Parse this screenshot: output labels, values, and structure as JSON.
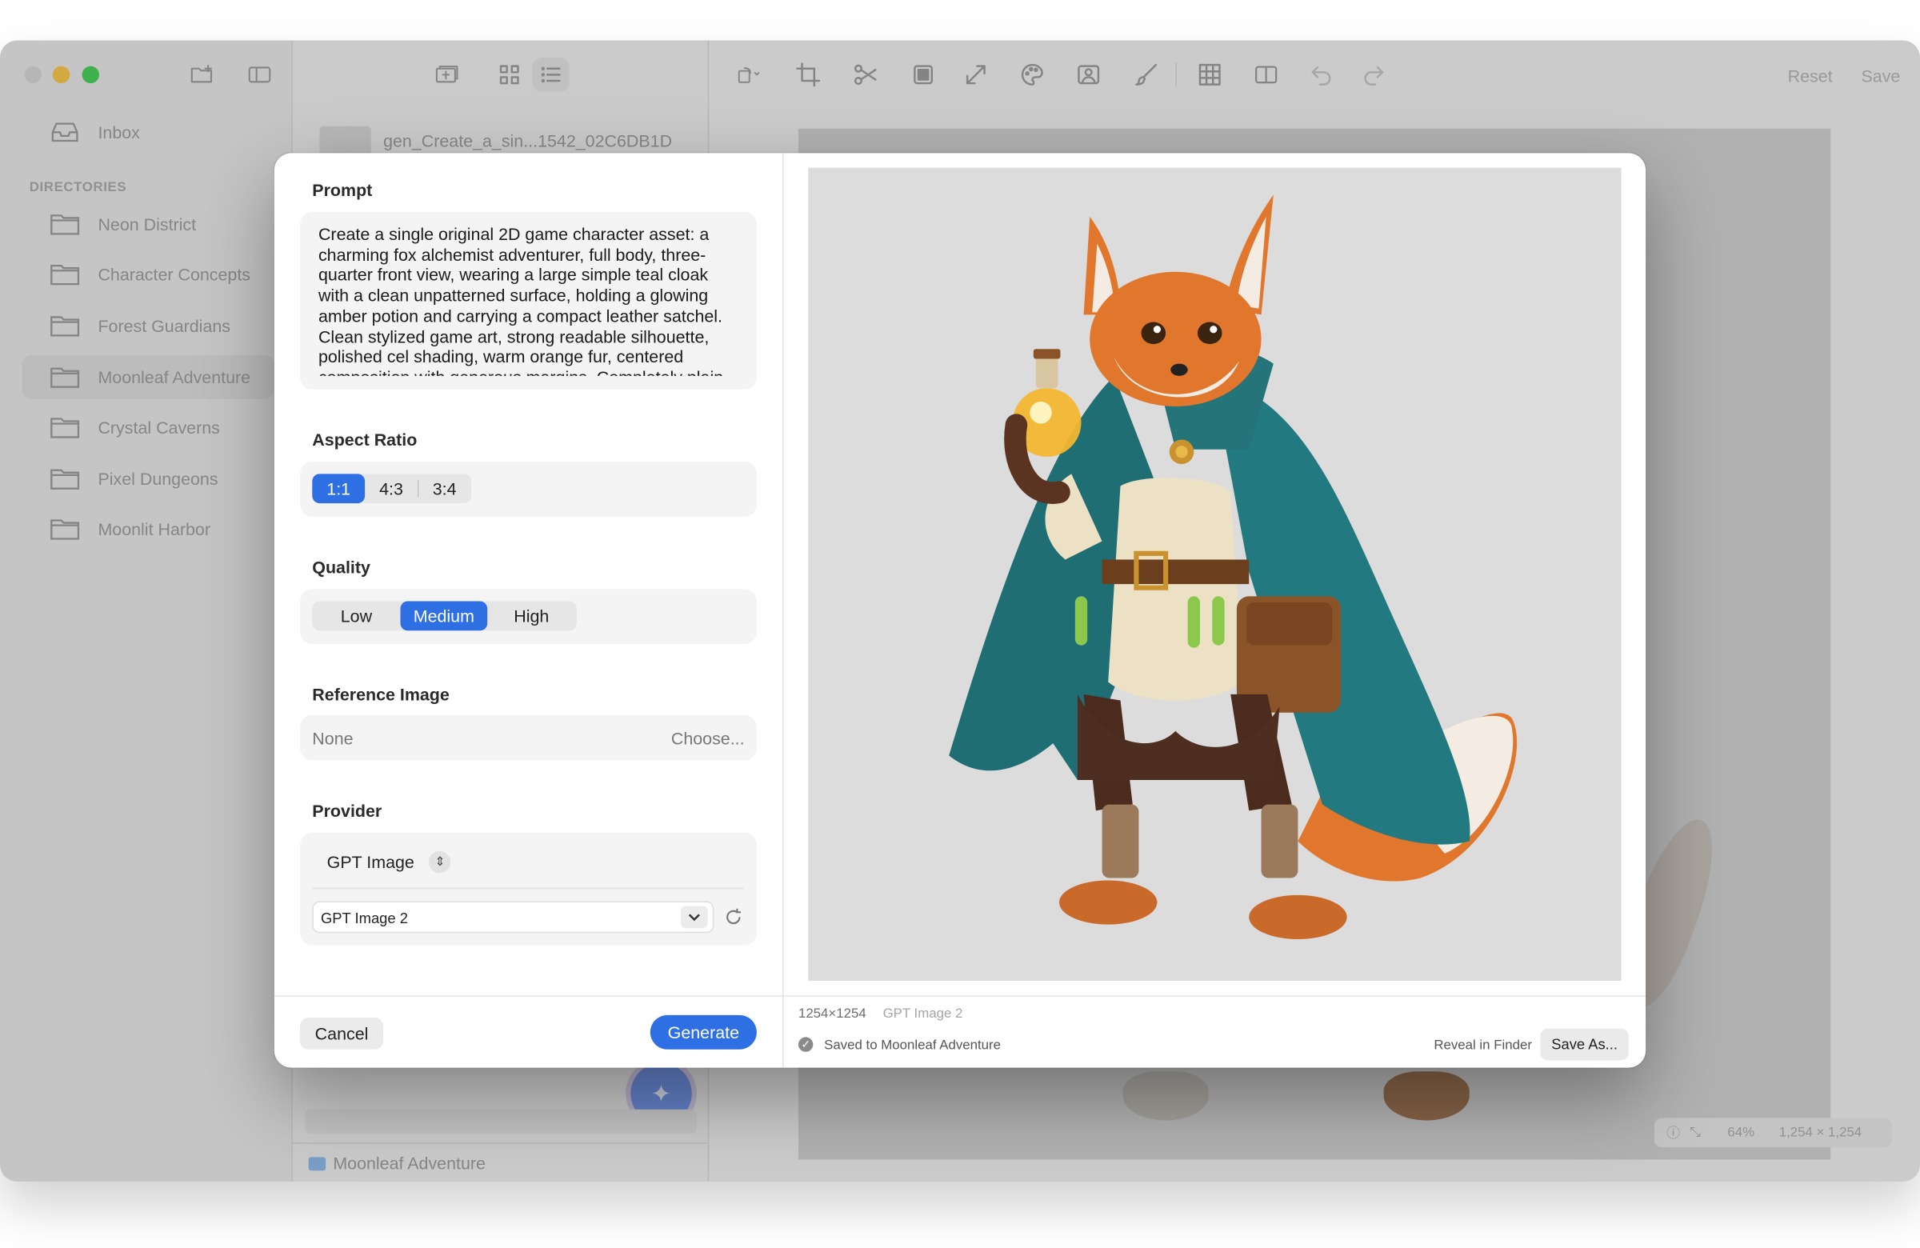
{
  "window": {
    "traffic_colors": {
      "close": "#f25f57",
      "minimize": "#f8bd2e",
      "zoom": "#2bc841"
    }
  },
  "sidebar": {
    "inbox_label": "Inbox",
    "directories_header": "DIRECTORIES",
    "directories": [
      {
        "label": "Neon District"
      },
      {
        "label": "Character Concepts"
      },
      {
        "label": "Forest Guardians"
      },
      {
        "label": "Moonleaf Adventure",
        "selected": true
      },
      {
        "label": "Crystal Caverns"
      },
      {
        "label": "Pixel Dungeons"
      },
      {
        "label": "Moonlit Harbor"
      }
    ]
  },
  "file_list": {
    "item_name": "gen_Create_a_sin...1542_02C6DB1D",
    "footer_folder": "Moonleaf Adventure"
  },
  "editor": {
    "reset_label": "Reset",
    "save_label": "Save",
    "zoom": "64%",
    "dimensions": "1,254 × 1,254"
  },
  "dialog": {
    "prompt_title": "Prompt",
    "prompt_text": "Create a single original 2D game character asset: a charming fox alchemist adventurer, full body, three-quarter front view, wearing a large simple teal cloak with a clean unpatterned surface, holding a glowing amber potion and carrying a compact leather satchel. Clean stylized game art, strong readable silhouette, polished cel shading, warm orange fur, centered composition with generous margins. Completely plain",
    "aspect_title": "Aspect Ratio",
    "aspect_options": [
      "1:1",
      "4:3",
      "3:4"
    ],
    "aspect_selected": "1:1",
    "quality_title": "Quality",
    "quality_options": [
      "Low",
      "Medium",
      "High"
    ],
    "quality_selected": "Medium",
    "reference_title": "Reference Image",
    "reference_value": "None",
    "reference_choose": "Choose...",
    "provider_title": "Provider",
    "provider_value": "GPT Image",
    "model_value": "GPT Image 2",
    "cancel_label": "Cancel",
    "generate_label": "Generate",
    "accent": "#2f6fe4"
  },
  "result": {
    "dimensions": "1254×1254",
    "model": "GPT Image 2",
    "saved_text": "Saved to Moonleaf Adventure",
    "reveal_label": "Reveal in Finder",
    "save_as_label": "Save As..."
  }
}
